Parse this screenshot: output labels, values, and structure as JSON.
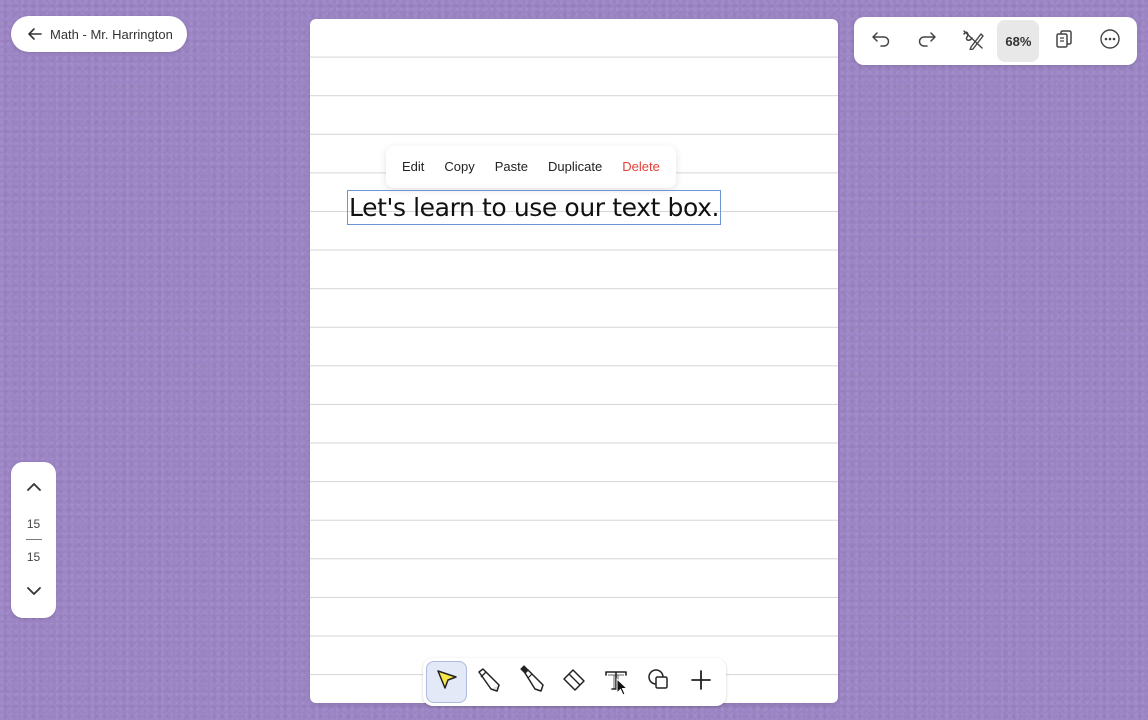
{
  "header": {
    "back_label": "Math - Mr. Harrington"
  },
  "top_toolbar": {
    "zoom_label": "68%",
    "buttons": [
      "undo-icon",
      "redo-icon",
      "pen-tool-icon",
      "zoom",
      "pages-icon",
      "more-icon"
    ]
  },
  "page_nav": {
    "current": "15",
    "total": "15"
  },
  "context_menu": {
    "edit": "Edit",
    "copy": "Copy",
    "paste": "Paste",
    "duplicate": "Duplicate",
    "delete": "Delete",
    "delete_color": "#e5413a"
  },
  "text_box": {
    "content": "Let's learn to use our text box."
  },
  "tool_bar": {
    "tools": [
      "pointer-tool-icon",
      "pencil-tool-icon",
      "marker-tool-icon",
      "eraser-tool-icon",
      "text-tool-icon",
      "shapes-tool-icon",
      "add-icon"
    ],
    "active": "pointer-tool-icon",
    "active_color": "#f7e64a"
  },
  "colors": {
    "background": "#9b84c4",
    "selection_border": "#6e94d8"
  }
}
